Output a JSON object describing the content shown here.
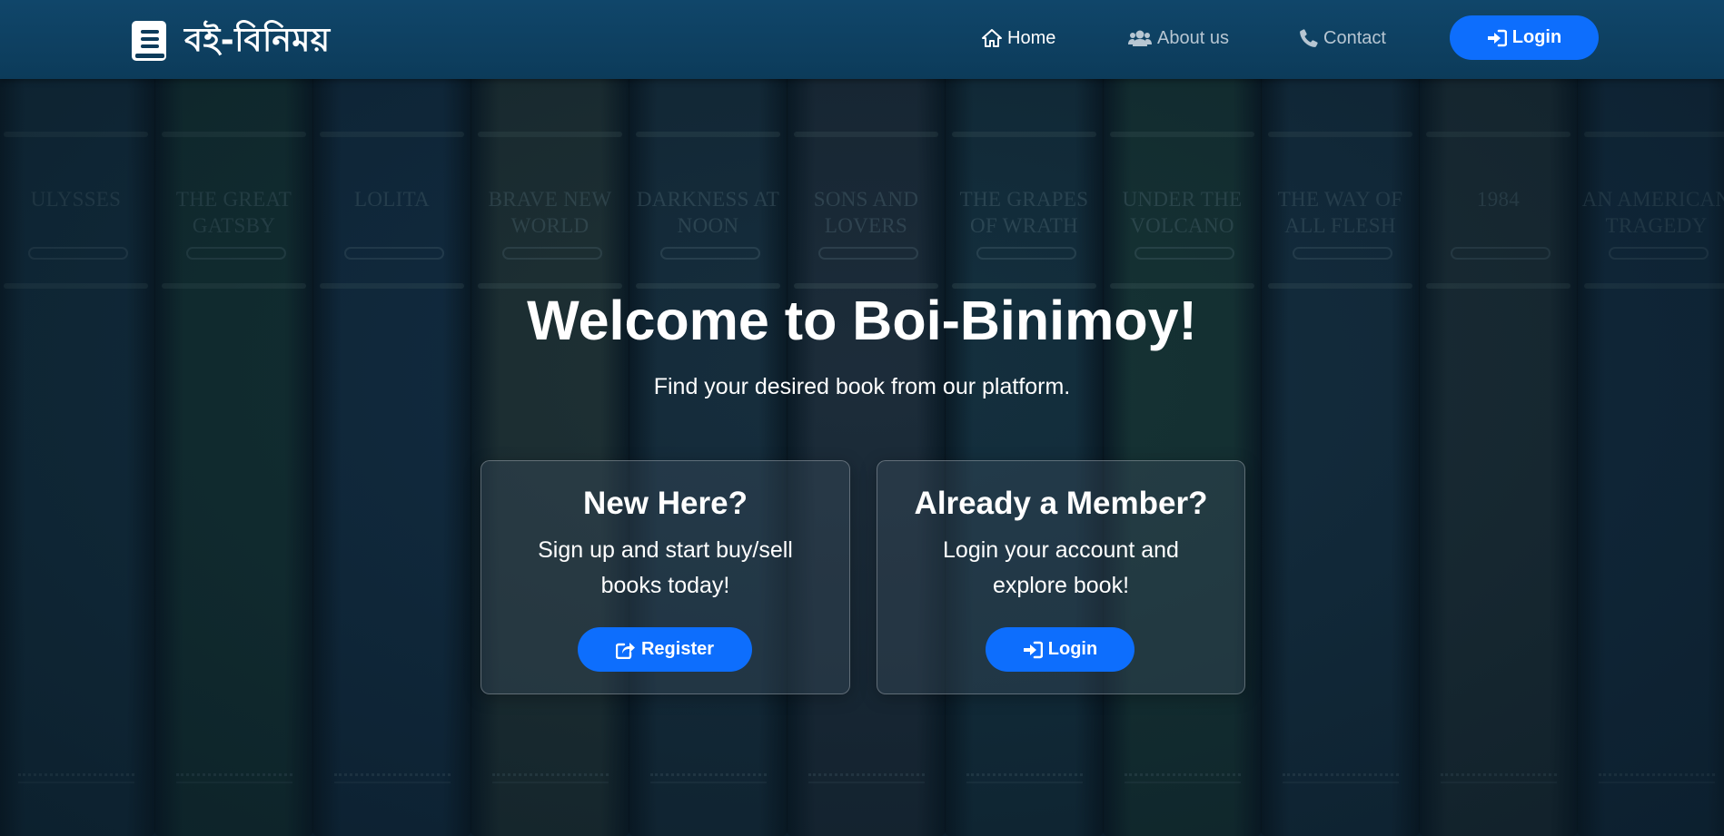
{
  "brand": {
    "logo_text": "বই-বিনিময়",
    "icon": "book-icon"
  },
  "nav": {
    "home": {
      "label": "Home",
      "icon": "home-icon"
    },
    "about": {
      "label": "About us",
      "icon": "users-icon"
    },
    "contact": {
      "label": "Contact",
      "icon": "phone-icon"
    },
    "login": {
      "label": "Login",
      "icon": "sign-in-icon"
    }
  },
  "background": {
    "spines": [
      {
        "title": "ULYSSES",
        "color": "#173648"
      },
      {
        "title": "THE GREAT GATSBY",
        "color": "#183b34"
      },
      {
        "title": "LOLITA",
        "color": "#15324a"
      },
      {
        "title": "BRAVE NEW WORLD",
        "color": "#2a3a36"
      },
      {
        "title": "DARKNESS AT NOON",
        "color": "#1b3342"
      },
      {
        "title": "SONS AND LOVERS",
        "color": "#24303c"
      },
      {
        "title": "THE GRAPES OF WRATH",
        "color": "#183644"
      },
      {
        "title": "UNDER THE VOLCANO",
        "color": "#1c3e36"
      },
      {
        "title": "THE WAY OF ALL FLESH",
        "color": "#193548"
      },
      {
        "title": "1984",
        "color": "#26363a"
      },
      {
        "title": "AN AMERICAN TRAGEDY",
        "color": "#17334a"
      }
    ]
  },
  "hero": {
    "title": "Welcome to Boi-Binimoy!",
    "subtitle": "Find your desired book from our platform."
  },
  "cards": {
    "new_here": {
      "title": "New Here?",
      "text": "Sign up and start buy/sell books today!",
      "button": "Register",
      "button_icon": "share-square-icon"
    },
    "member": {
      "title": "Already a Member?",
      "text": "Login your account and explore book!",
      "button": "Login",
      "button_icon": "sign-in-icon"
    }
  },
  "colors": {
    "navbar": "#0c3b5a",
    "primary_button": "#0d6efd",
    "nav_active": "#ffffff",
    "nav_inactive": "#b7c6d2"
  }
}
